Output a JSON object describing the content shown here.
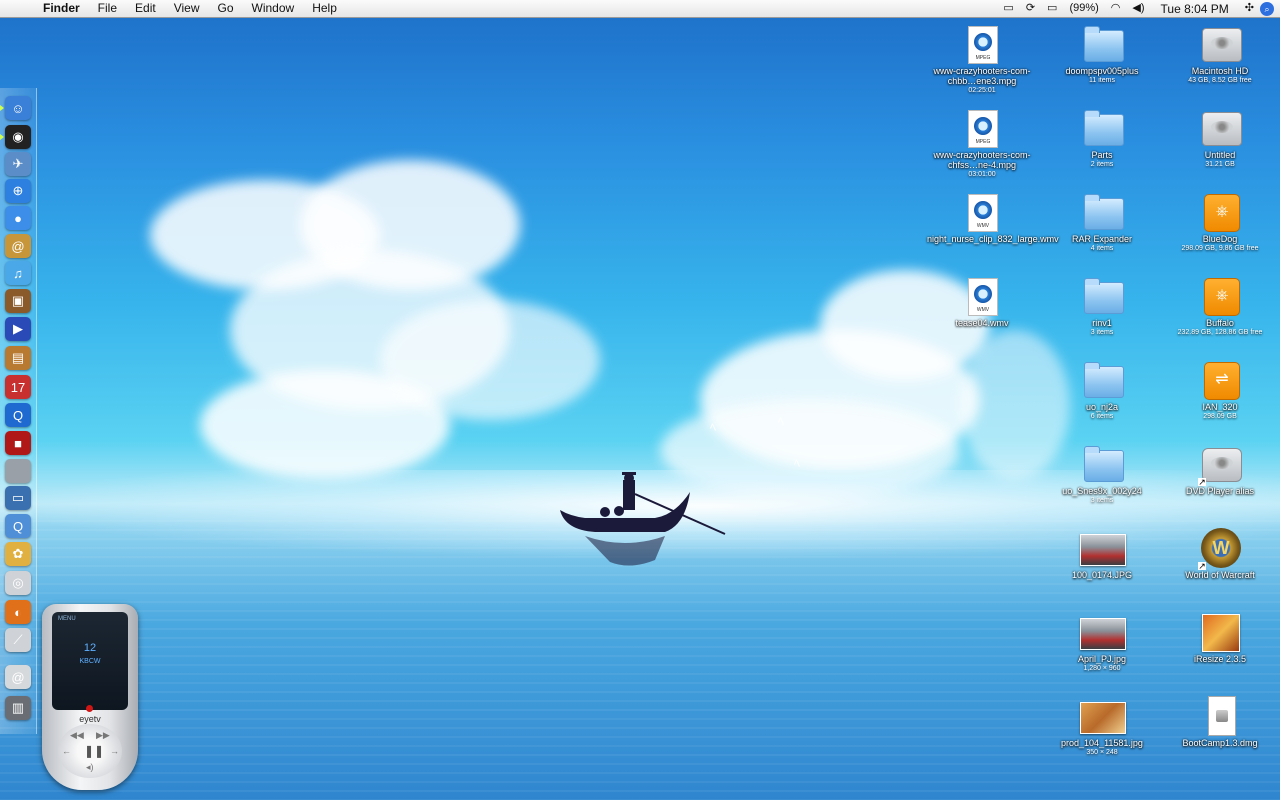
{
  "menubar": {
    "app": "Finder",
    "menus": [
      "File",
      "Edit",
      "View",
      "Go",
      "Window",
      "Help"
    ],
    "battery": "(99%)",
    "clock": "Tue 8:04 PM"
  },
  "dock": {
    "icons": [
      {
        "name": "finder-icon",
        "color": "#3a7fd8",
        "glyph": "☺"
      },
      {
        "name": "dashboard-icon",
        "color": "#222222",
        "glyph": "◉"
      },
      {
        "name": "mail-stamp-icon",
        "color": "#5b8ec8",
        "glyph": "✈"
      },
      {
        "name": "safari-icon",
        "color": "#2d7fe0",
        "glyph": "⊕"
      },
      {
        "name": "ichat-icon",
        "color": "#3c8ee8",
        "glyph": "●"
      },
      {
        "name": "address-book-icon",
        "color": "#c8963a",
        "glyph": "@"
      },
      {
        "name": "itunes-icon",
        "color": "#4aa8e8",
        "glyph": "♫"
      },
      {
        "name": "iphoto-icon",
        "color": "#8a5a2a",
        "glyph": "▣"
      },
      {
        "name": "imovie-icon",
        "color": "#2a4ab8",
        "glyph": "▶"
      },
      {
        "name": "photo-album-icon",
        "color": "#b87a30",
        "glyph": "▤"
      },
      {
        "name": "ical-icon",
        "color": "#c83030",
        "glyph": "17"
      },
      {
        "name": "quicktime-icon",
        "color": "#1f6ad0",
        "glyph": "Q"
      },
      {
        "name": "flix-icon",
        "color": "#b01818",
        "glyph": "■"
      },
      {
        "name": "system-prefs-icon",
        "color": "#9aa0a8",
        "glyph": ""
      },
      {
        "name": "remote-desktop-icon",
        "color": "#3a6fb0",
        "glyph": "▭"
      },
      {
        "name": "quicktime-player-icon",
        "color": "#4f8fd8",
        "glyph": "Q"
      },
      {
        "name": "popcorn-icon",
        "color": "#e0b040",
        "glyph": "✿"
      },
      {
        "name": "dvd-player-icon",
        "color": "#cfd2d6",
        "glyph": "◎"
      },
      {
        "name": "firefox-icon",
        "color": "#e0701a",
        "glyph": "◐"
      },
      {
        "name": "utility-icon",
        "color": "#cfd2d6",
        "glyph": "⟋"
      },
      {
        "name": "downloads-stack-icon",
        "color": "#d6d9dc",
        "glyph": "@"
      },
      {
        "name": "trash-icon",
        "color": "#6a6e74",
        "glyph": "▥"
      }
    ]
  },
  "remote": {
    "menu": "MENU",
    "channel": "12",
    "callsign": "KBCW",
    "brand": "eyetv"
  },
  "desktop_icons": [
    {
      "label": "www-crazyhooters-com-chbb…ene3.mpg",
      "sub": "02:25:01",
      "type": "mpeg"
    },
    {
      "label": "www-crazyhooters-com-chfss…ne-4.mpg",
      "sub": "03:01:00",
      "type": "mpeg"
    },
    {
      "label": "night_nurse_clip_832_large.wmv",
      "sub": "",
      "type": "wmv"
    },
    {
      "label": "tease04.wmv",
      "sub": "",
      "type": "wmv"
    },
    {
      "label": "doompspv005plus",
      "sub": "11 items",
      "type": "folder"
    },
    {
      "label": "Parts",
      "sub": "2 items",
      "type": "folder"
    },
    {
      "label": "RAR Expander",
      "sub": "4 items",
      "type": "folder"
    },
    {
      "label": "rinv1",
      "sub": "3 items",
      "type": "folder"
    },
    {
      "label": "uo_nj2a",
      "sub": "6 items",
      "type": "folder"
    },
    {
      "label": "uo_Snes9x_002y24",
      "sub": "3 items",
      "type": "folder"
    },
    {
      "label": "100_0174.JPG",
      "sub": "",
      "type": "photo"
    },
    {
      "label": "April_PJ.jpg",
      "sub": "1,280 × 960",
      "type": "photo"
    },
    {
      "label": "prod_104_11581.jpg",
      "sub": "350 × 248",
      "type": "photo2"
    },
    {
      "label": "Macintosh HD",
      "sub": "43 GB, 8.52 GB free",
      "type": "disk"
    },
    {
      "label": "Untitled",
      "sub": "31.21 GB",
      "type": "disk"
    },
    {
      "label": "BlueDog",
      "sub": "298.09 GB, 9.86 GB free",
      "type": "ext"
    },
    {
      "label": "Buffalo",
      "sub": "232.89 GB, 128.86 GB free",
      "type": "ext"
    },
    {
      "label": "IAN_320",
      "sub": "298.09 GB",
      "type": "usb"
    },
    {
      "label": "DVD Player alias",
      "sub": "",
      "type": "dvd"
    },
    {
      "label": "World of Warcraft",
      "sub": "",
      "type": "wow"
    },
    {
      "label": "iResize 2.3.5",
      "sub": "",
      "type": "app"
    },
    {
      "label": "BootCamp1.3.dmg",
      "sub": "",
      "type": "dmg"
    }
  ]
}
